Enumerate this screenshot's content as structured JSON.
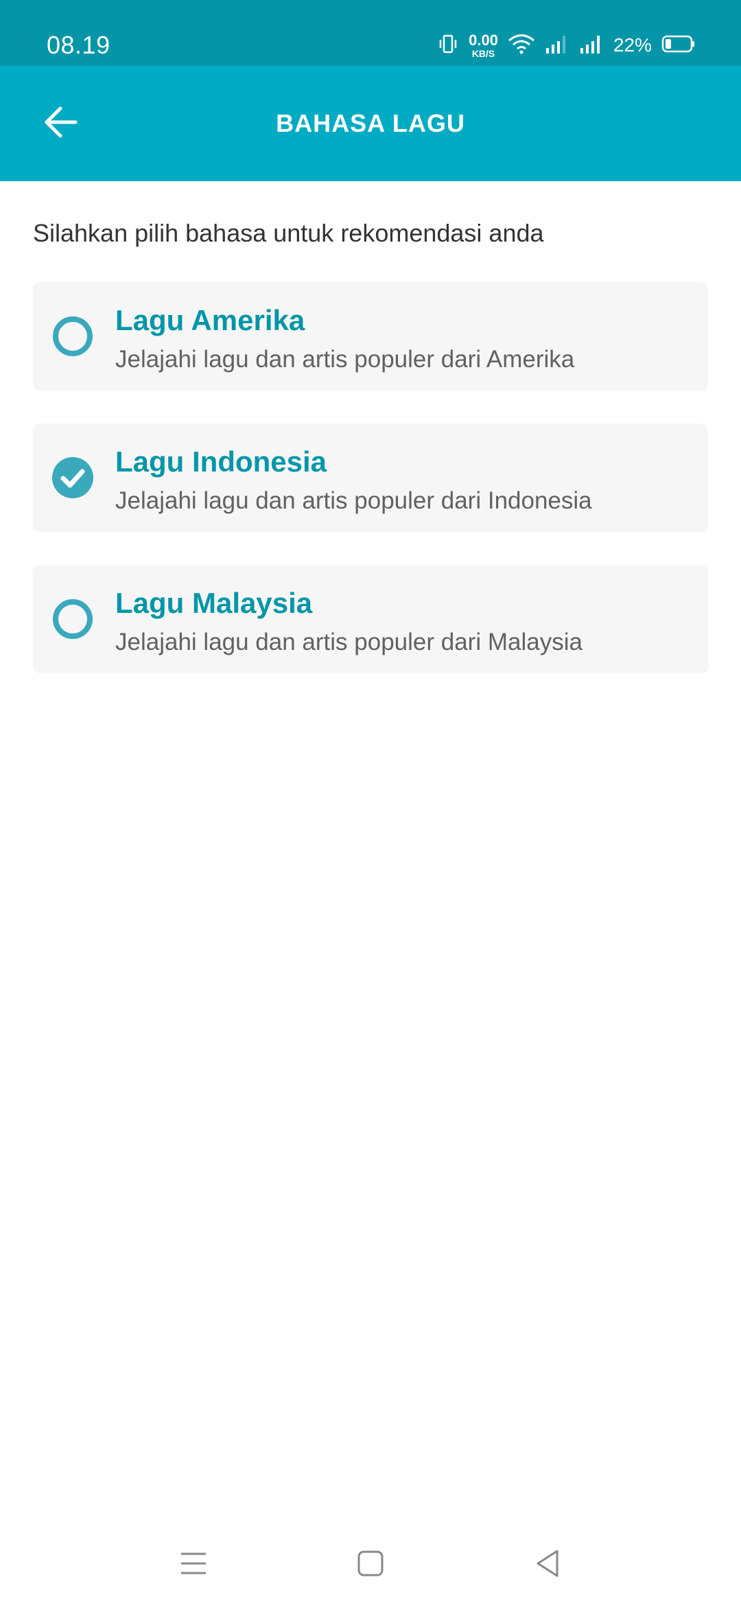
{
  "status_bar": {
    "time": "08.19",
    "net_speed_value": "0.00",
    "net_speed_unit": "KB/S",
    "battery_percent": "22%",
    "icons": [
      "vibrate-icon",
      "wifi-icon",
      "signal-icon",
      "signal-icon",
      "battery-icon"
    ]
  },
  "app_bar": {
    "title": "BAHASA LAGU",
    "back_icon": "arrow-left-icon"
  },
  "content": {
    "subtitle": "Silahkan pilih bahasa untuk rekomendasi anda",
    "options": [
      {
        "title": "Lagu Amerika",
        "description": "Jelajahi lagu dan artis populer dari Amerika",
        "selected": false
      },
      {
        "title": "Lagu Indonesia",
        "description": "Jelajahi lagu dan artis populer dari Indonesia",
        "selected": true
      },
      {
        "title": "Lagu Malaysia",
        "description": "Jelajahi lagu dan artis populer dari Malaysia",
        "selected": false
      }
    ]
  },
  "nav_bar": {
    "icons": [
      "menu-icon",
      "home-icon",
      "back-triangle-icon"
    ]
  },
  "colors": {
    "status_bar": "#0496a8",
    "app_bar": "#02abc4",
    "accent": "#3aa9bd",
    "option_title": "#0496a8",
    "card_background": "#f6f6f6"
  }
}
